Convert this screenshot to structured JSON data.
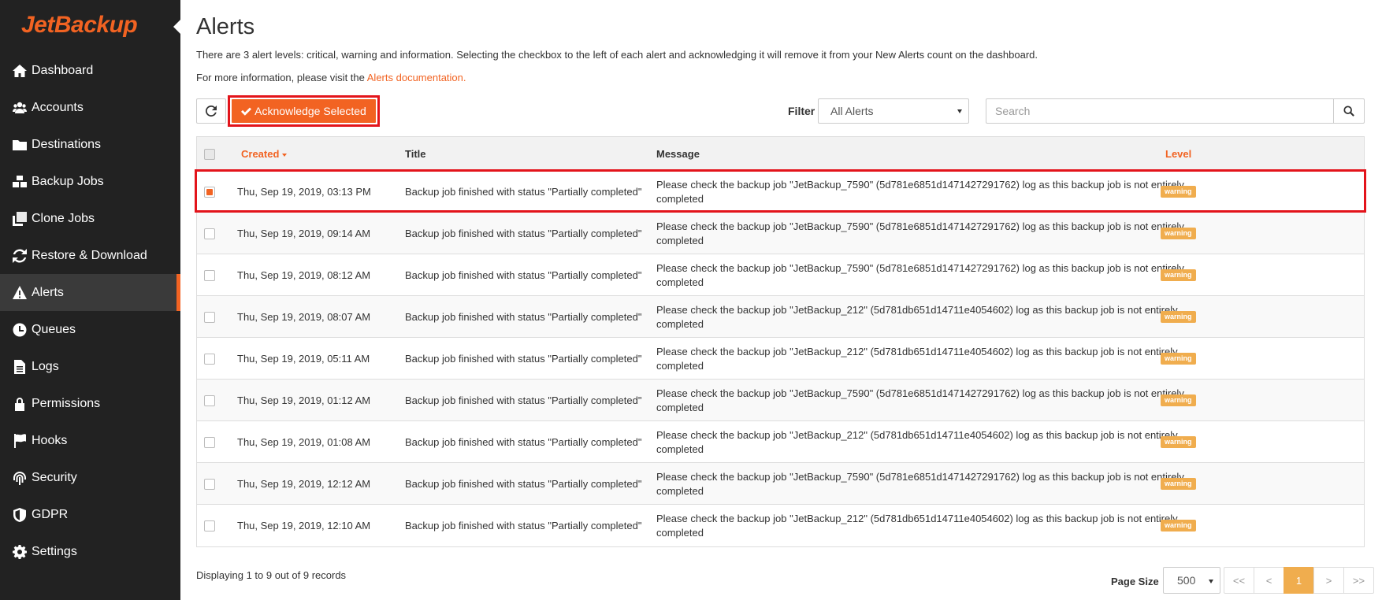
{
  "brand": {
    "logo_text": "JetBackup",
    "accent": "#f26322"
  },
  "sidebar": {
    "items": [
      {
        "label": "Dashboard",
        "icon": "home-icon"
      },
      {
        "label": "Accounts",
        "icon": "users-icon"
      },
      {
        "label": "Destinations",
        "icon": "folder-icon"
      },
      {
        "label": "Backup Jobs",
        "icon": "cubes-icon"
      },
      {
        "label": "Clone Jobs",
        "icon": "clone-icon"
      },
      {
        "label": "Restore & Download",
        "icon": "refresh-icon"
      },
      {
        "label": "Alerts",
        "icon": "warning-icon",
        "active": true
      },
      {
        "label": "Queues",
        "icon": "clock-icon"
      },
      {
        "label": "Logs",
        "icon": "file-icon"
      },
      {
        "label": "Permissions",
        "icon": "lock-icon"
      },
      {
        "label": "Hooks",
        "icon": "flag-icon"
      },
      {
        "label": "Security",
        "icon": "fingerprint-icon"
      },
      {
        "label": "GDPR",
        "icon": "shield-icon"
      },
      {
        "label": "Settings",
        "icon": "gear-icon"
      }
    ]
  },
  "page": {
    "title": "Alerts",
    "description": "There are 3 alert levels: critical, warning and information. Selecting the checkbox to the left of each alert and acknowledging it will remove it from your New Alerts count on the dashboard.",
    "more_info_prefix": "For more information, please visit the ",
    "more_info_link": "Alerts documentation."
  },
  "toolbar": {
    "acknowledge_label": "Acknowledge Selected",
    "filter_label": "Filter",
    "filter_value": "All Alerts",
    "search_placeholder": "Search"
  },
  "table": {
    "headers": {
      "created": "Created",
      "title": "Title",
      "message": "Message",
      "level": "Level"
    },
    "rows": [
      {
        "checked": true,
        "created": "Thu, Sep 19, 2019, 03:13 PM",
        "title": "Backup job finished with status \"Partially completed\"",
        "message": "Please check the backup job \"JetBackup_7590\" (5d781e6851d1471427291762) log as this backup job is not entirely completed",
        "level": "warning"
      },
      {
        "checked": false,
        "created": "Thu, Sep 19, 2019, 09:14 AM",
        "title": "Backup job finished with status \"Partially completed\"",
        "message": "Please check the backup job \"JetBackup_7590\" (5d781e6851d1471427291762) log as this backup job is not entirely completed",
        "level": "warning"
      },
      {
        "checked": false,
        "created": "Thu, Sep 19, 2019, 08:12 AM",
        "title": "Backup job finished with status \"Partially completed\"",
        "message": "Please check the backup job \"JetBackup_7590\" (5d781e6851d1471427291762) log as this backup job is not entirely completed",
        "level": "warning"
      },
      {
        "checked": false,
        "created": "Thu, Sep 19, 2019, 08:07 AM",
        "title": "Backup job finished with status \"Partially completed\"",
        "message": "Please check the backup job \"JetBackup_212\" (5d781db651d14711e4054602) log as this backup job is not entirely completed",
        "level": "warning"
      },
      {
        "checked": false,
        "created": "Thu, Sep 19, 2019, 05:11 AM",
        "title": "Backup job finished with status \"Partially completed\"",
        "message": "Please check the backup job \"JetBackup_212\" (5d781db651d14711e4054602) log as this backup job is not entirely completed",
        "level": "warning"
      },
      {
        "checked": false,
        "created": "Thu, Sep 19, 2019, 01:12 AM",
        "title": "Backup job finished with status \"Partially completed\"",
        "message": "Please check the backup job \"JetBackup_7590\" (5d781e6851d1471427291762) log as this backup job is not entirely completed",
        "level": "warning"
      },
      {
        "checked": false,
        "created": "Thu, Sep 19, 2019, 01:08 AM",
        "title": "Backup job finished with status \"Partially completed\"",
        "message": "Please check the backup job \"JetBackup_212\" (5d781db651d14711e4054602) log as this backup job is not entirely completed",
        "level": "warning"
      },
      {
        "checked": false,
        "created": "Thu, Sep 19, 2019, 12:12 AM",
        "title": "Backup job finished with status \"Partially completed\"",
        "message": "Please check the backup job \"JetBackup_7590\" (5d781e6851d1471427291762) log as this backup job is not entirely completed",
        "level": "warning"
      },
      {
        "checked": false,
        "created": "Thu, Sep 19, 2019, 12:10 AM",
        "title": "Backup job finished with status \"Partially completed\"",
        "message": "Please check the backup job \"JetBackup_212\" (5d781db651d14711e4054602) log as this backup job is not entirely completed",
        "level": "warning"
      }
    ]
  },
  "footer": {
    "display_text": "Displaying 1 to 9 out of 9 records",
    "page_size_label": "Page Size",
    "page_size_value": "500",
    "pager": [
      "<<",
      "<",
      "1",
      ">",
      ">>"
    ],
    "current_page": "1"
  }
}
